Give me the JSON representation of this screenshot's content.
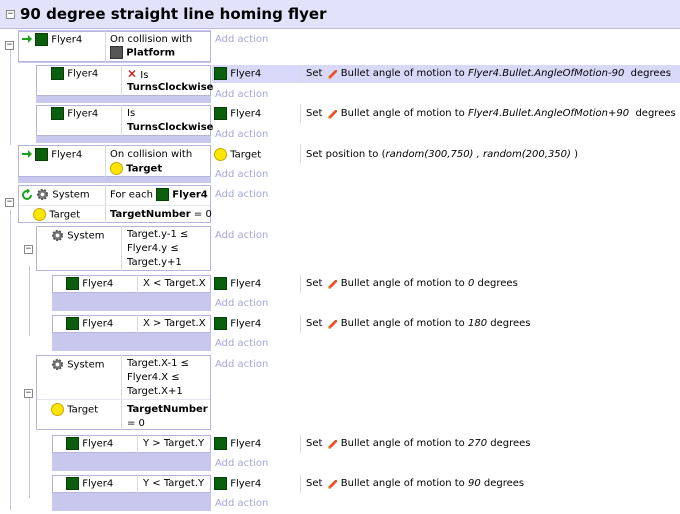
{
  "header": {
    "title": "90 degree straight line homing flyer"
  },
  "add_action": "Add action",
  "colors": {
    "header_bg": "#e2e2fa",
    "event_panel": "#c8c8ee",
    "add_action_text": "#a6a6de"
  },
  "e1": {
    "obj": "Flyer4",
    "cond1": "On collision with",
    "cond2": "Platform"
  },
  "e1a": {
    "obj": "Flyer4",
    "cond1": "Is",
    "cond2": "TurnsClockwise",
    "act_obj": "Flyer4",
    "act_pre": "Set",
    "act_mid": "Bullet angle of motion to",
    "act_expr": "Flyer4.Bullet.AngleOfMotion-90",
    "act_unit": "degrees"
  },
  "e1b": {
    "obj": "Flyer4",
    "cond1": "Is",
    "cond2": "TurnsClockwise",
    "act_obj": "Flyer4",
    "act_pre": "Set",
    "act_mid": "Bullet angle of motion to",
    "act_expr": "Flyer4.Bullet.AngleOfMotion+90",
    "act_unit": "degrees"
  },
  "e2": {
    "obj": "Flyer4",
    "cond1": "On collision with",
    "cond2": "Target",
    "act_obj": "Target",
    "act_pre": "Set position to (",
    "act_expr": "random(300,750) , random(200,350)",
    "act_post": " )"
  },
  "e3": {
    "sys": "System",
    "foreach": "For each",
    "foreach_obj": "Flyer4",
    "obj": "Target",
    "cond_pre": "TargetNumber",
    "cond_post": "= 0"
  },
  "e3a": {
    "sys": "System",
    "cond": [
      "Target.y-1 ≤",
      "Flyer4.y ≤",
      "Target.y+1"
    ]
  },
  "e3a1": {
    "obj": "Flyer4",
    "cond": "X < Target.X",
    "act_obj": "Flyer4",
    "act_pre": "Set",
    "act_mid": "Bullet angle of motion to",
    "act_expr": "0",
    "act_unit": "degrees"
  },
  "e3a2": {
    "obj": "Flyer4",
    "cond": "X > Target.X",
    "act_obj": "Flyer4",
    "act_pre": "Set",
    "act_mid": "Bullet angle of motion to",
    "act_expr": "180",
    "act_unit": "degrees"
  },
  "e3b": {
    "sys": "System",
    "cond": [
      "Target.X-1 ≤",
      "Flyer4.X ≤",
      "Target.X+1"
    ],
    "obj": "Target",
    "cond2": "TargetNumber",
    "cond2_post": "= 0"
  },
  "e3b1": {
    "obj": "Flyer4",
    "cond": "Y > Target.Y",
    "act_obj": "Flyer4",
    "act_pre": "Set",
    "act_mid": "Bullet angle of motion to",
    "act_expr": "270",
    "act_unit": "degrees"
  },
  "e3b2": {
    "obj": "Flyer4",
    "cond": "Y < Target.Y",
    "act_obj": "Flyer4",
    "act_pre": "Set",
    "act_mid": "Bullet angle of motion to",
    "act_expr": "90",
    "act_unit": "degrees"
  }
}
